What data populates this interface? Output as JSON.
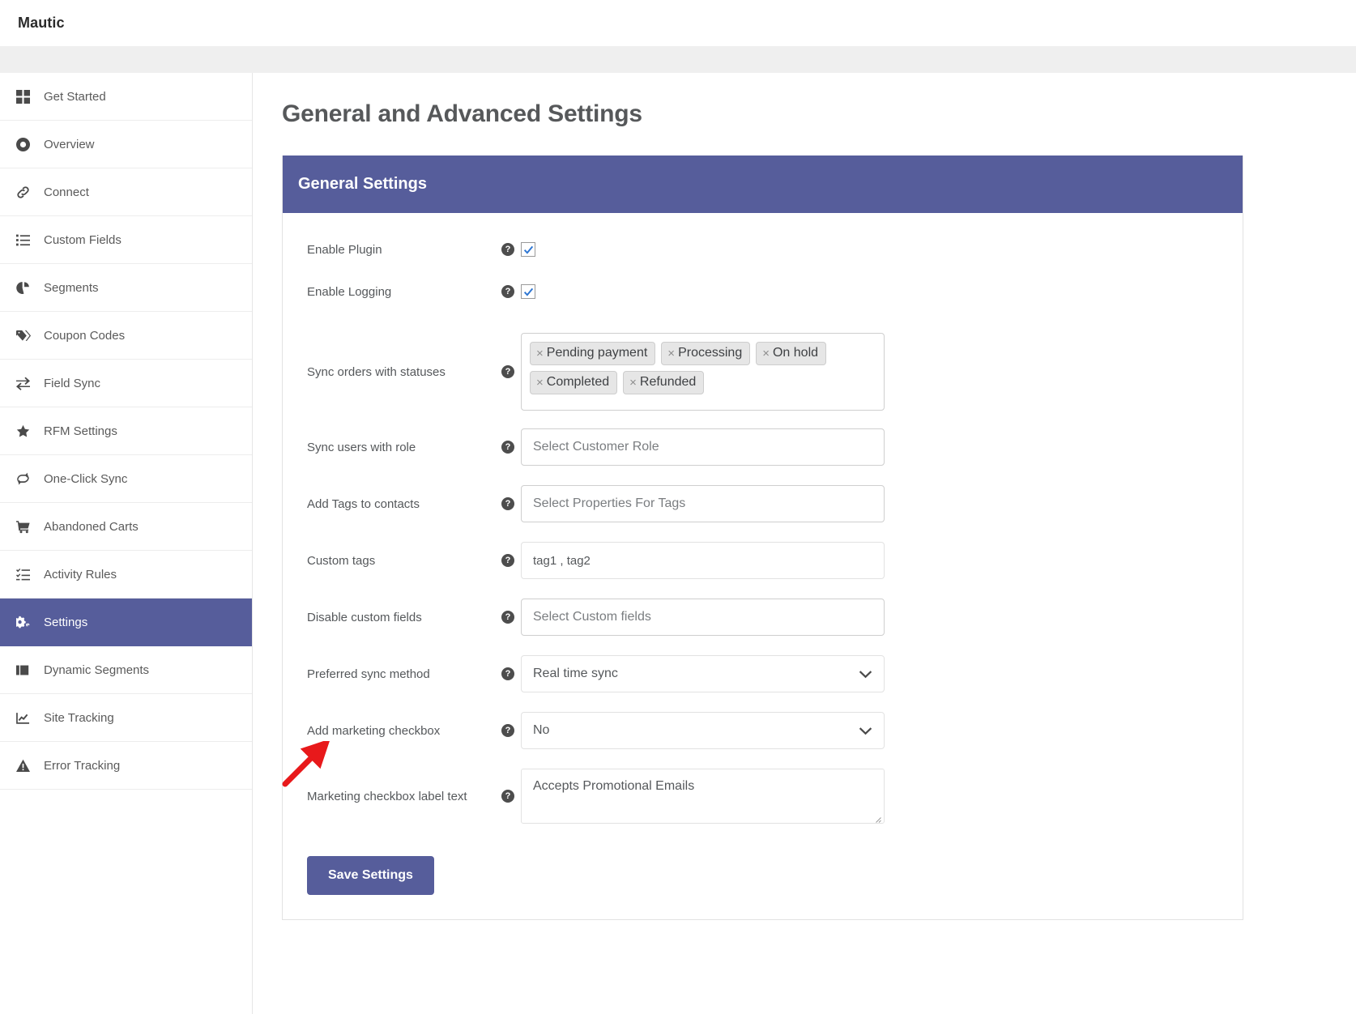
{
  "app": {
    "brand": "Mautic"
  },
  "sidebar": {
    "items": [
      {
        "label": "Get Started",
        "icon": "grid-icon",
        "active": false
      },
      {
        "label": "Overview",
        "icon": "lifebuoy-icon",
        "active": false
      },
      {
        "label": "Connect",
        "icon": "link-icon",
        "active": false
      },
      {
        "label": "Custom Fields",
        "icon": "list-icon",
        "active": false
      },
      {
        "label": "Segments",
        "icon": "pie-chart-icon",
        "active": false
      },
      {
        "label": "Coupon Codes",
        "icon": "tag-icon",
        "active": false
      },
      {
        "label": "Field Sync",
        "icon": "exchange-icon",
        "active": false
      },
      {
        "label": "RFM Settings",
        "icon": "star-icon",
        "active": false
      },
      {
        "label": "One-Click Sync",
        "icon": "refresh-icon",
        "active": false
      },
      {
        "label": "Abandoned Carts",
        "icon": "cart-icon",
        "active": false
      },
      {
        "label": "Activity Rules",
        "icon": "task-list-icon",
        "active": false
      },
      {
        "label": "Settings",
        "icon": "gears-icon",
        "active": true
      },
      {
        "label": "Dynamic Segments",
        "icon": "layers-icon",
        "active": false
      },
      {
        "label": "Site Tracking",
        "icon": "chart-line-icon",
        "active": false
      },
      {
        "label": "Error Tracking",
        "icon": "warning-icon",
        "active": false
      }
    ]
  },
  "main": {
    "page_title": "General and Advanced Settings",
    "panel_title": "General Settings",
    "help_glyph": "?",
    "fields": {
      "enable_plugin": {
        "label": "Enable Plugin",
        "checked": true
      },
      "enable_logging": {
        "label": "Enable Logging",
        "checked": true
      },
      "sync_orders_statuses": {
        "label": "Sync orders with statuses",
        "chips": [
          "Pending payment",
          "Processing",
          "On hold",
          "Completed",
          "Refunded"
        ],
        "remove_glyph": "×"
      },
      "sync_users_role": {
        "label": "Sync users with role",
        "placeholder": "Select Customer Role",
        "value": ""
      },
      "add_tags": {
        "label": "Add Tags to contacts",
        "placeholder": "Select Properties For Tags",
        "value": ""
      },
      "custom_tags": {
        "label": "Custom tags",
        "placeholder": "tag1 , tag2",
        "value": "tag1 , tag2"
      },
      "disable_custom_fields": {
        "label": "Disable custom fields",
        "placeholder": "Select Custom fields",
        "value": ""
      },
      "preferred_sync_method": {
        "label": "Preferred sync method",
        "value": "Real time sync"
      },
      "add_marketing_checkbox": {
        "label": "Add marketing checkbox",
        "value": "No"
      },
      "marketing_checkbox_label_text": {
        "label": "Marketing checkbox label text",
        "value": "Accepts Promotional Emails"
      }
    },
    "save_label": "Save Settings"
  },
  "colors": {
    "accent": "#565d9b",
    "annotation": "#e8191b",
    "sidebar_border": "#e6e6e6",
    "panel_border": "#e3e3e3",
    "text": "#55585b"
  }
}
